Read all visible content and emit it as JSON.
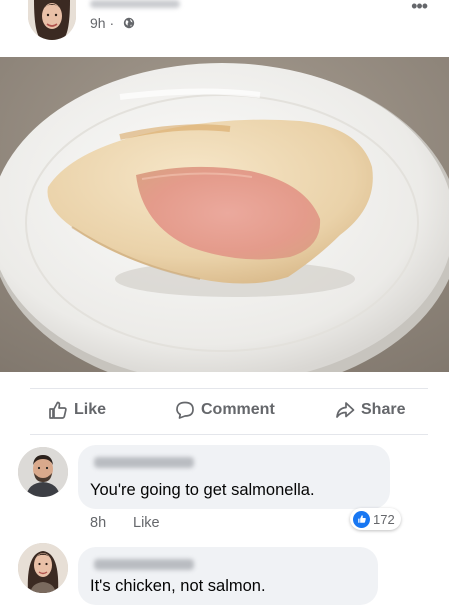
{
  "post": {
    "time": "9h ·",
    "more_glyph": "•••",
    "photo_subject": "chicken breast on a white plate"
  },
  "actions": {
    "like": "Like",
    "comment": "Comment",
    "share": "Share"
  },
  "comments": [
    {
      "text": "You're going to get salmonella.",
      "time": "8h",
      "like": "Like",
      "reaction_count": "172"
    },
    {
      "text": "It's chicken, not salmon."
    }
  ],
  "icons": {
    "globe": "globe-icon",
    "like": "thumbs-up-icon",
    "comment": "speech-bubble-icon",
    "share": "share-arrow-icon"
  },
  "colors": {
    "accent": "#1877f2",
    "muted_text": "#65676b",
    "bubble_bg": "#f0f2f5"
  }
}
